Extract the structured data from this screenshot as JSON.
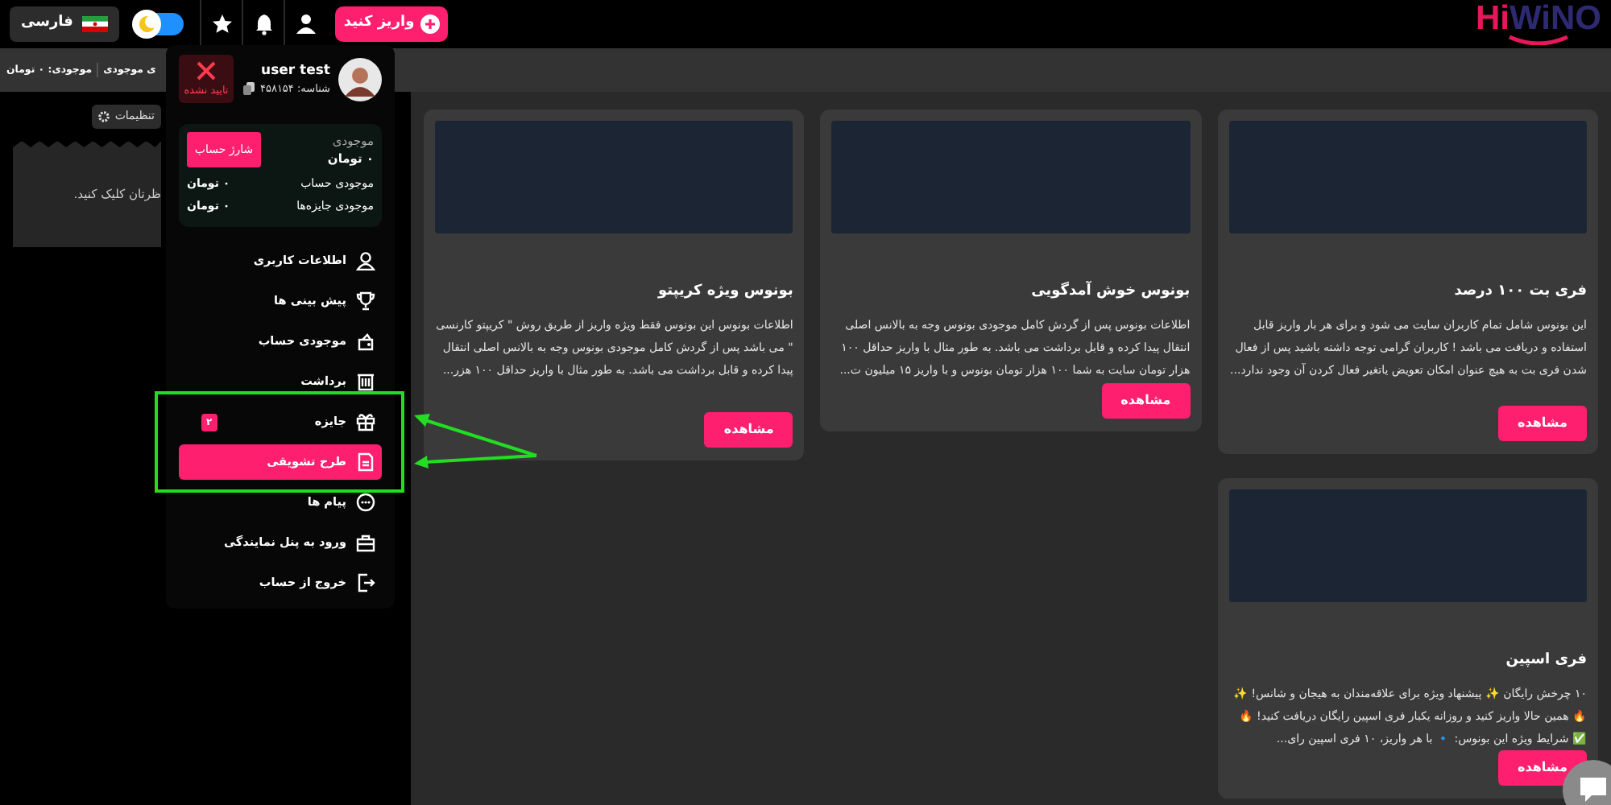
{
  "header": {
    "logo": "**Hi**WiNO",
    "deposit_button": "واریز کنید",
    "theme_toggle": {
      "on": true
    },
    "language": "فارسی"
  },
  "subbar": {
    "items": [
      "ی موجودی",
      "موجودی: ۰ تومان"
    ]
  },
  "sidebar": {
    "settings_button": "تنظیمات",
    "panel_text": "ظرتان کلیک کنید."
  },
  "cards": [
    {
      "title": "فری بت ۱۰۰ درصد",
      "description": "این بونوس شامل تمام کاربران سایت می شود و برای هر بار واریز قابل استفاده و دریافت می باشد ! کاربران گرامی توجه داشته باشید پس از فعال شدن فری بت به هیچ عنوان امکان تعویض یاتغیر فعال کردن آن وجود ندارد...",
      "button": "مشاهده"
    },
    {
      "title": "بونوس خوش آمدگویی",
      "description": "اطلاعات بونوس پس از گردش کامل موجودی بونوس وجه به بالانس اصلی انتقال پیدا کرده و قابل برداشت می باشد. به طور مثال با واریز حداقل ۱۰۰ هزار تومان سایت به شما ۱۰۰ هزار تومان بونوس و با واریز ۱۵ میلیون ت...",
      "button": "مشاهده"
    },
    {
      "title": "بونوس ویژه کریپتو",
      "description": "اطلاعات بونوس این بونوس فقط ویژه واریز از طریق روش \" کریپتو کارنسی \" می باشد پس از گردش کامل موجودی بونوس وجه به بالانس اصلی انتقال پیدا کرده و قابل برداشت می باشد. به طور مثال با واریز حداقل ۱۰۰ هزر...",
      "button": "مشاهده"
    },
    {
      "title": "فری اسپین",
      "description": "۱۰ چرخش رایگان ✨ پیشنهاد ویژه برای علاقه‌مندان به هیجان و شانس! ✨ 🔥 همین حالا واریز کنید و روزانه یکبار فری اسپین رایگان دریافت کنید! 🔥 ✅ شرایط ویژه این بونوس: 🔹 با هر واریز، ۱۰ فری اسپین رای...",
      "button": "مشاهده"
    }
  ],
  "user_menu": {
    "username": "user test",
    "user_id": "شناسه: ۴۵۸۱۵۴",
    "verified": false,
    "verify_label": "تایید نشده",
    "balance_label": "موجودی",
    "balance": "۰ تومان",
    "charge_button": "شارژ حساب",
    "balances": [
      {
        "label": "موجودی حساب",
        "value": "۰ تومان"
      },
      {
        "label": "موجودی جایزه‌ها",
        "value": "۰ تومان"
      }
    ],
    "items": [
      {
        "label": "اطلاعات کاربری",
        "selected": false
      },
      {
        "label": "پیش بینی ها",
        "selected": false
      },
      {
        "label": "موجودی حساب",
        "selected": false
      },
      {
        "label": "برداشت",
        "selected": false
      },
      {
        "label": "جایزه",
        "selected": false,
        "badge": "۲"
      },
      {
        "label": "طرح تشویقی",
        "selected": true
      },
      {
        "label": "پیام ها",
        "selected": false
      },
      {
        "label": "ورود به پنل نمایندگی",
        "selected": false
      },
      {
        "label": "خروج از حساب",
        "selected": false
      }
    ]
  }
}
